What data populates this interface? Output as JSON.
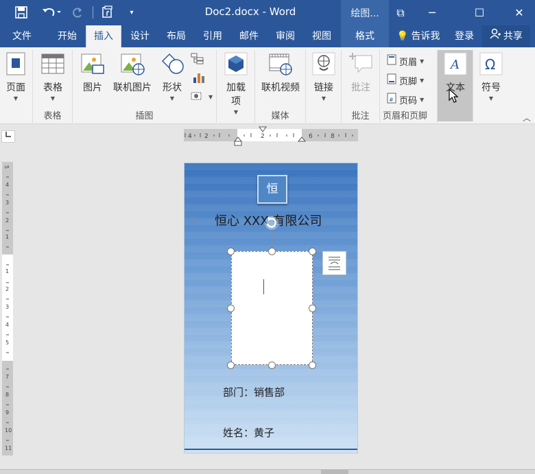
{
  "window": {
    "title": "Doc2.docx - Word",
    "context_group": "绘图...",
    "restore_glyph": "⧉",
    "minimize_glyph": "─",
    "maximize_glyph": "☐",
    "close_glyph": "✕"
  },
  "tabs": [
    "文件",
    "开始",
    "插入",
    "设计",
    "布局",
    "引用",
    "邮件",
    "审阅",
    "视图",
    "格式"
  ],
  "active_tab": "插入",
  "tell_me": "告诉我",
  "login": "登录",
  "share": "共享",
  "ribbon": {
    "groups": {
      "pages": "",
      "tables": "表格",
      "illustrations": "插图",
      "addins": "",
      "media": "媒体",
      "links": "",
      "comments": "批注",
      "header_footer": "页眉和页脚"
    },
    "buttons": {
      "page": "页面",
      "table": "表格",
      "picture": "图片",
      "online_picture": "联机图片",
      "shapes": "形状",
      "addins": "加载\n项",
      "addins_line1": "加载",
      "addins_line2": "项",
      "online_video": "联机视频",
      "link": "链接",
      "comment": "批注",
      "header": "页眉",
      "footer": "页脚",
      "page_number": "页码",
      "text": "文本",
      "symbol": "符号"
    }
  },
  "document": {
    "logo_char": "恒",
    "company": "恒心 XXX 有限公司",
    "department_label": "部门：",
    "department_value": "销售部",
    "name_label": "姓名：",
    "name_value": "黄子"
  },
  "colors": {
    "brand": "#2b579a",
    "card_top": "#3a74bd",
    "card_bottom": "#cfe2f4"
  }
}
